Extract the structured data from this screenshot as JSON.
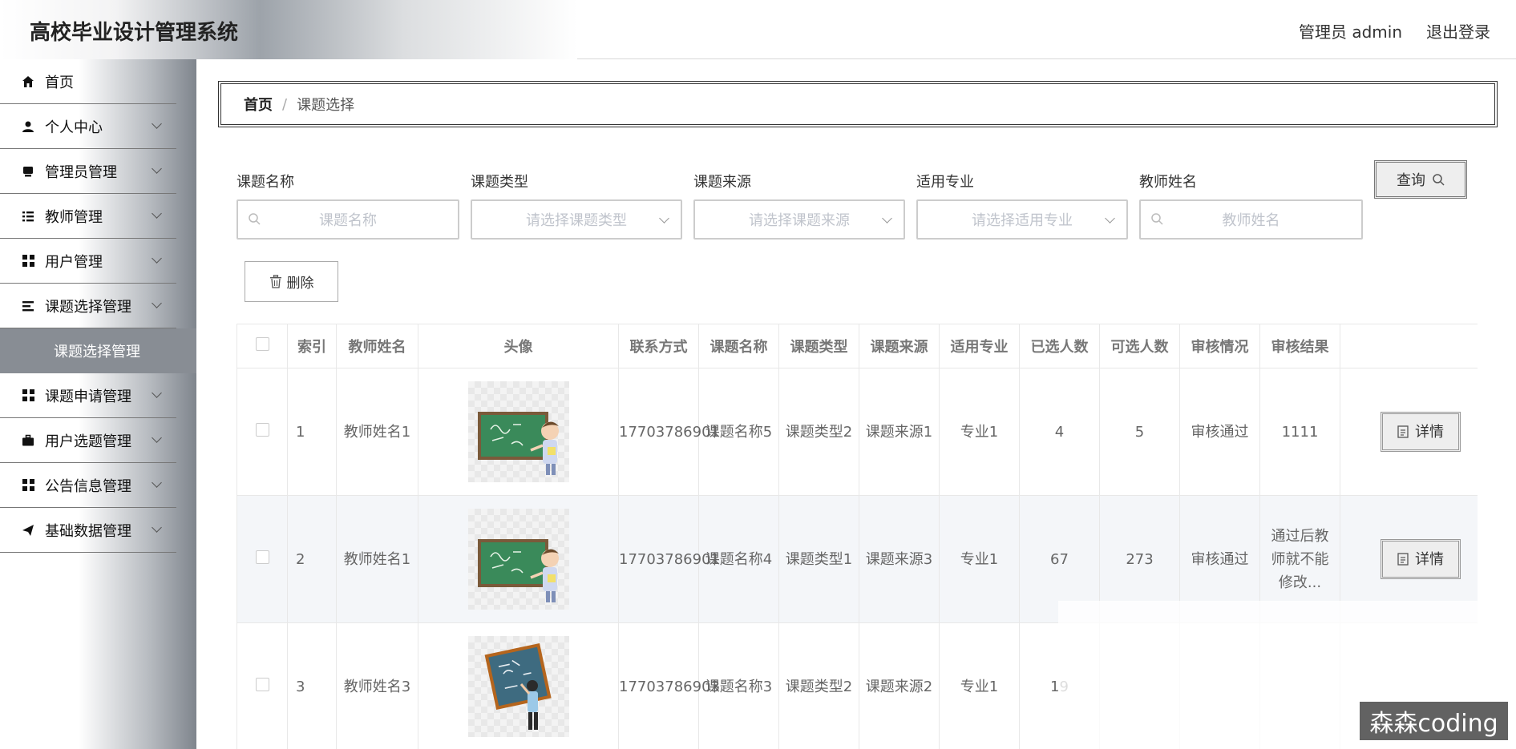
{
  "header": {
    "title": "高校毕业设计管理系统",
    "user": "管理员 admin",
    "logout": "退出登录"
  },
  "sidebar": {
    "items": [
      {
        "label": "首页",
        "icon": "home-icon"
      },
      {
        "label": "个人中心",
        "icon": "user-icon"
      },
      {
        "label": "管理员管理",
        "icon": "admin-icon"
      },
      {
        "label": "教师管理",
        "icon": "list-icon"
      },
      {
        "label": "用户管理",
        "icon": "grid-icon"
      },
      {
        "label": "课题选择管理",
        "icon": "list-icon"
      },
      {
        "label": "课题申请管理",
        "icon": "grid-icon"
      },
      {
        "label": "用户选题管理",
        "icon": "briefcase-icon"
      },
      {
        "label": "公告信息管理",
        "icon": "grid-icon"
      },
      {
        "label": "基础数据管理",
        "icon": "send-icon"
      }
    ],
    "submenu_label": "课题选择管理"
  },
  "breadcrumb": {
    "home": "首页",
    "separator": "/",
    "current": "课题选择"
  },
  "filters": [
    {
      "label": "课题名称",
      "placeholder": "课题名称"
    },
    {
      "label": "课题类型",
      "placeholder": "请选择课题类型"
    },
    {
      "label": "课题来源",
      "placeholder": "请选择课题来源"
    },
    {
      "label": "适用专业",
      "placeholder": "请选择适用专业"
    },
    {
      "label": "教师姓名",
      "placeholder": "教师姓名"
    }
  ],
  "query_button": "查询",
  "delete_button": "删除",
  "table": {
    "headers": [
      "索引",
      "教师姓名",
      "头像",
      "联系方式",
      "课题名称",
      "课题类型",
      "课题来源",
      "适用专业",
      "已选人数",
      "可选人数",
      "审核情况",
      "审核结果"
    ],
    "rows": [
      {
        "index": "1",
        "teacher": "教师姓名1",
        "phone": "17703786901",
        "topic": "课题名称5",
        "type": "课题类型2",
        "source": "课题来源1",
        "major": "专业1",
        "selected": "4",
        "available": "5",
        "review": "审核通过",
        "result": "1111",
        "action": "详情"
      },
      {
        "index": "2",
        "teacher": "教师姓名1",
        "phone": "17703786901",
        "topic": "课题名称4",
        "type": "课题类型1",
        "source": "课题来源3",
        "major": "专业1",
        "selected": "67",
        "available": "273",
        "review": "审核通过",
        "result": "通过后教师就不能修改...",
        "action": "详情"
      },
      {
        "index": "3",
        "teacher": "教师姓名3",
        "phone": "17703786903",
        "topic": "课题名称3",
        "type": "课题类型2",
        "source": "课题来源2",
        "major": "专业1",
        "selected": "19",
        "available": "",
        "review": "",
        "result": "",
        "action": ""
      }
    ]
  },
  "watermark": "森森coding"
}
